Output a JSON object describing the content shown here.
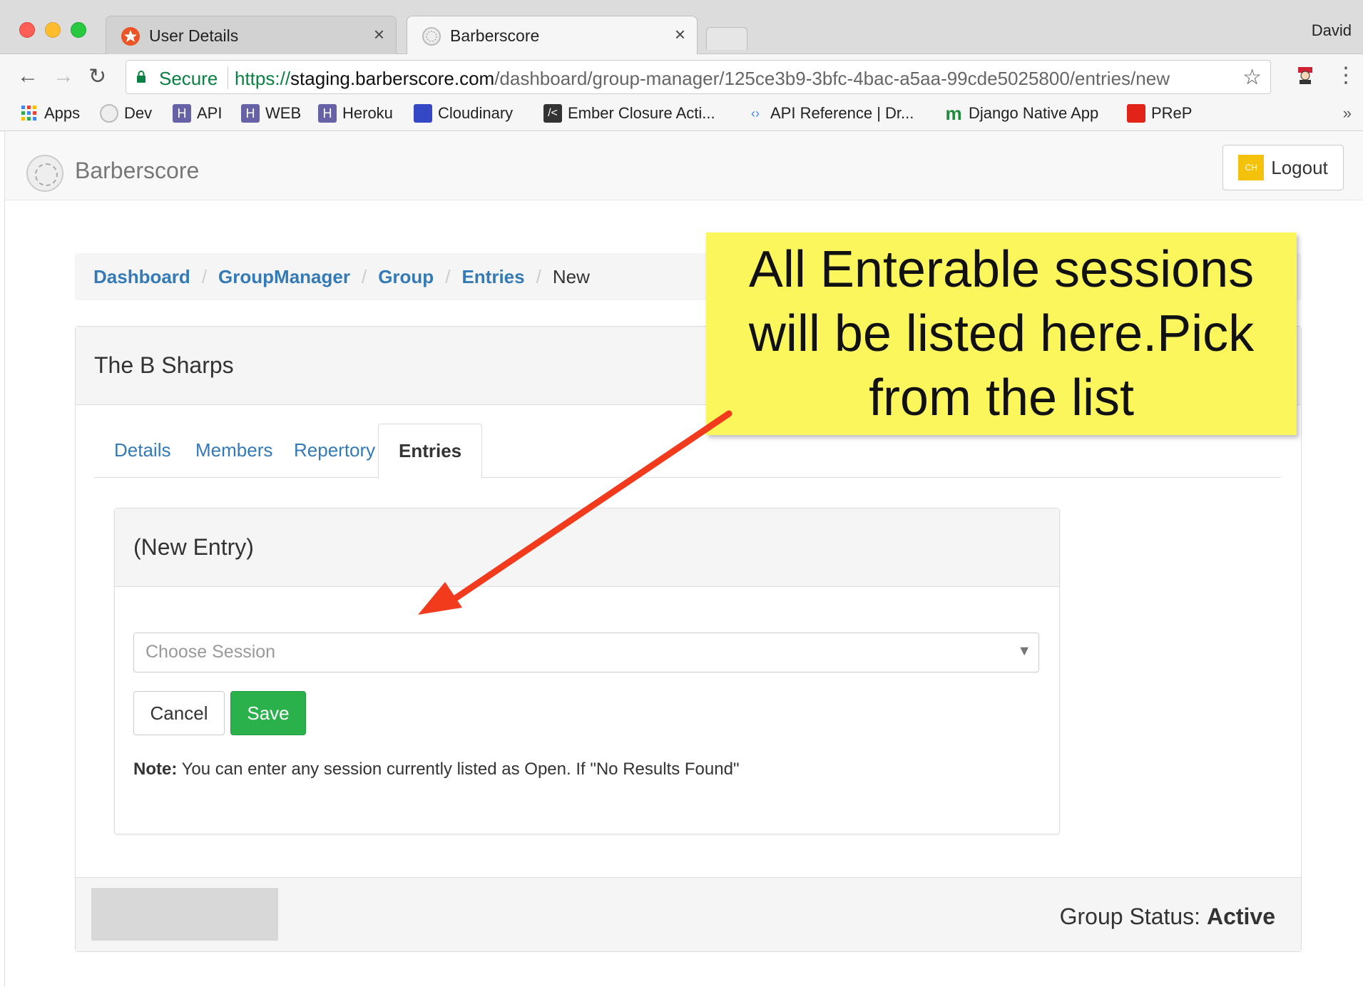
{
  "browser": {
    "tabs": [
      {
        "title": "User Details",
        "icon": "auth0-icon"
      },
      {
        "title": "Barberscore",
        "icon": "barberscore-icon"
      }
    ],
    "profile_name": "David",
    "address_bar": {
      "secure_label": "Secure",
      "url_scheme": "https://",
      "url_host": "staging.barberscore.com",
      "url_path": "/dashboard/group-manager/125ce3b9-3bfc-4bac-a5aa-99cde5025800/entries/new"
    },
    "bookmarks": [
      {
        "label": "Apps",
        "color": "#4285f4"
      },
      {
        "label": "Dev",
        "color": "#e0e0e0"
      },
      {
        "label": "API",
        "color": "#6762a6"
      },
      {
        "label": "WEB",
        "color": "#6762a6"
      },
      {
        "label": "Heroku",
        "color": "#6762a6"
      },
      {
        "label": "Cloudinary",
        "color": "#3448c5"
      },
      {
        "label": "Ember Closure Acti...",
        "color": "#333333"
      },
      {
        "label": "API Reference  |  Dr...",
        "color": "#e0e0e0"
      },
      {
        "label": "Django Native App",
        "color": "#1c8b3c"
      },
      {
        "label": "PReP",
        "color": "#e2231a"
      }
    ],
    "bookmarks_more": "»"
  },
  "navbar": {
    "brand": "Barberscore",
    "logout_label": "Logout",
    "avatar_text": "CH"
  },
  "breadcrumb": {
    "items": [
      "Dashboard",
      "GroupManager",
      "Group",
      "Entries"
    ],
    "active": "New",
    "separator": "/"
  },
  "group_panel": {
    "title": "The B Sharps",
    "tabs": [
      "Details",
      "Members",
      "Repertory",
      "Entries"
    ],
    "active_tab": "Entries"
  },
  "entry_form": {
    "title": "(New Entry)",
    "session_placeholder": "Choose Session",
    "cancel_label": "Cancel",
    "save_label": "Save",
    "note_label": "Note:",
    "note_text": " You can enter any session currently listed as Open. If \"No Results Found\""
  },
  "footer": {
    "status_label": "Group Status:",
    "status_value": "Active"
  },
  "annotation": {
    "text": "All Enterable sessions will be listed here.Pick from the list",
    "background": "#fbf65c",
    "arrow_color": "#f23a1d"
  },
  "colors": {
    "link": "#337ab7",
    "save_button": "#2ab14b",
    "secure": "#0b8043"
  }
}
